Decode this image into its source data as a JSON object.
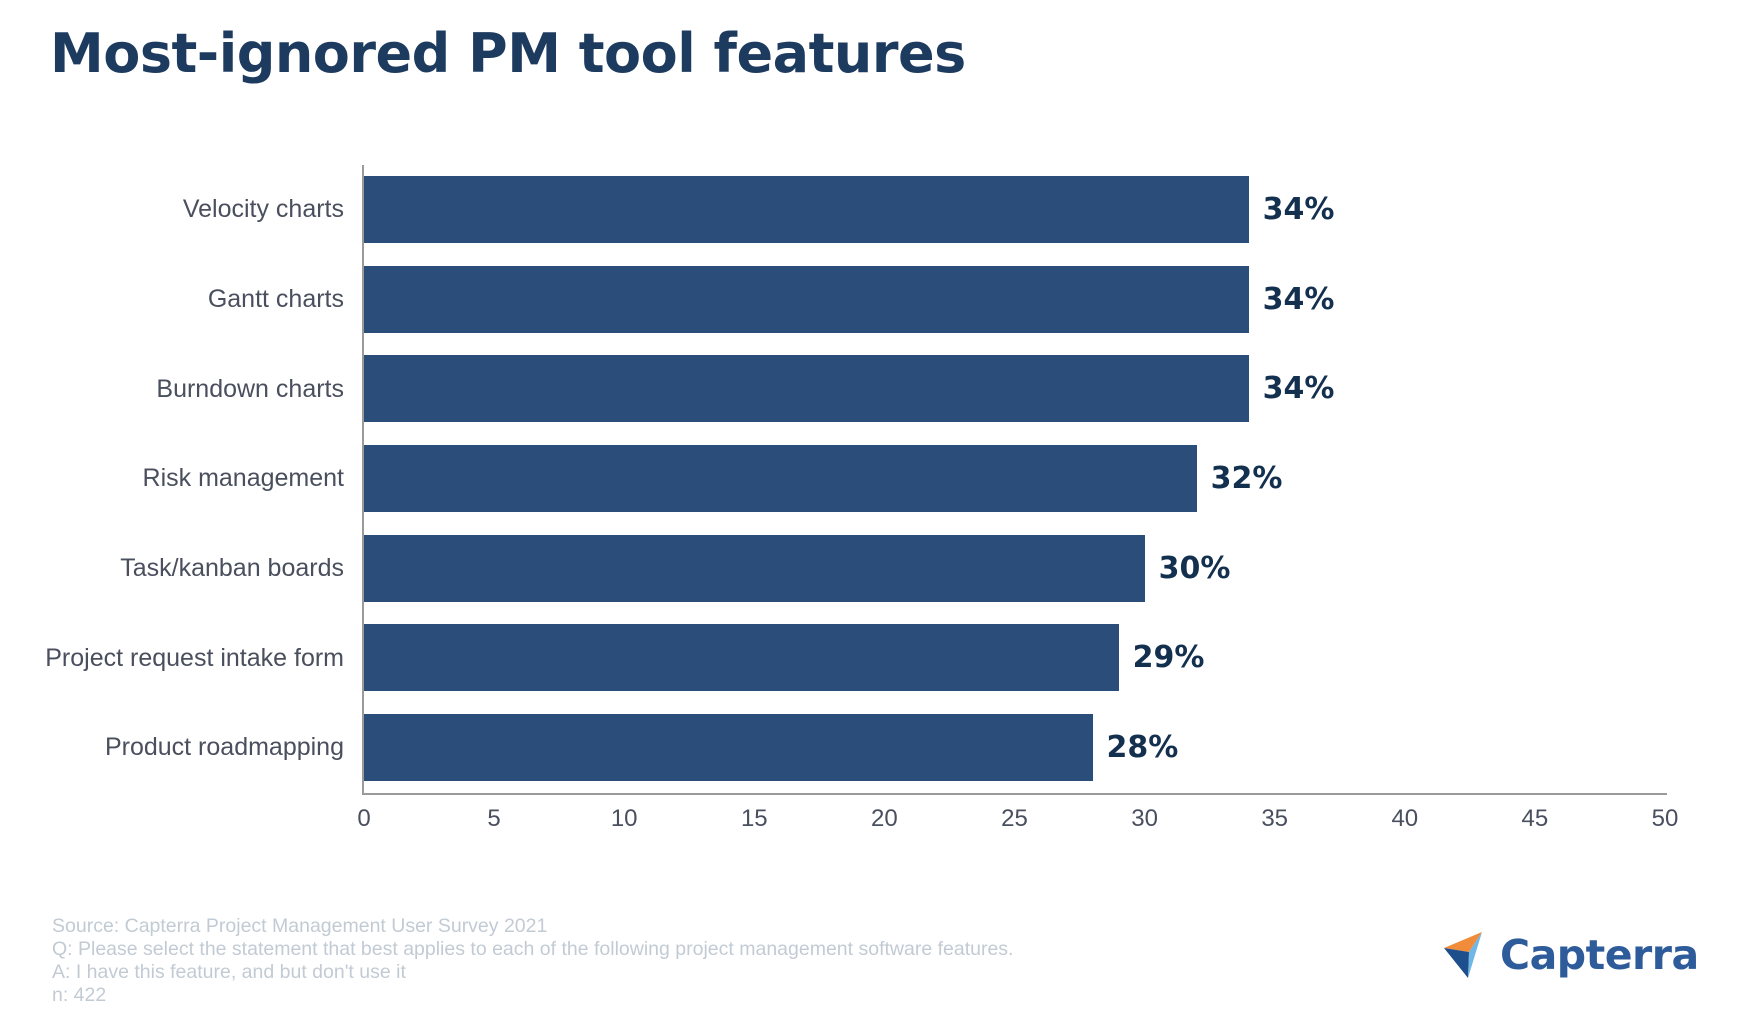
{
  "title": "Most-ignored PM tool features",
  "chart_data": {
    "type": "bar",
    "orientation": "horizontal",
    "title": "Most-ignored PM tool features",
    "categories": [
      "Velocity charts",
      "Gantt charts",
      "Burndown charts",
      "Risk management",
      "Task/kanban boards",
      "Project request intake form",
      "Product roadmapping"
    ],
    "values": [
      34,
      34,
      34,
      32,
      30,
      29,
      28
    ],
    "value_labels": [
      "34%",
      "34%",
      "34%",
      "32%",
      "30%",
      "29%",
      "28%"
    ],
    "xlabel": "",
    "ylabel": "",
    "xlim": [
      0,
      50
    ],
    "xticks": [
      0,
      5,
      10,
      15,
      20,
      25,
      30,
      35,
      40,
      45,
      50
    ],
    "xtick_labels": [
      "0",
      "5",
      "10",
      "15",
      "20",
      "25",
      "30",
      "35",
      "40",
      "45",
      "50"
    ],
    "grid": false,
    "legend": false,
    "bar_color": "#2a4e79",
    "label_color": "#14304f",
    "title_color": "#1d3a5f"
  },
  "footnote": {
    "line1": "Source: Capterra Project Management User Survey 2021",
    "line2": "Q: Please select the statement that best applies to each of the following project management software features.",
    "line3": "A: I have this feature, and but don't use it",
    "line4": "n: 422",
    "color": "#c2cbd4"
  },
  "logo": {
    "name": "Capterra",
    "mark_colors": {
      "orange": "#f08c3a",
      "light_blue": "#6fb7e6",
      "navy": "#1d4f8c"
    },
    "text_color": "#2e5b9a"
  }
}
